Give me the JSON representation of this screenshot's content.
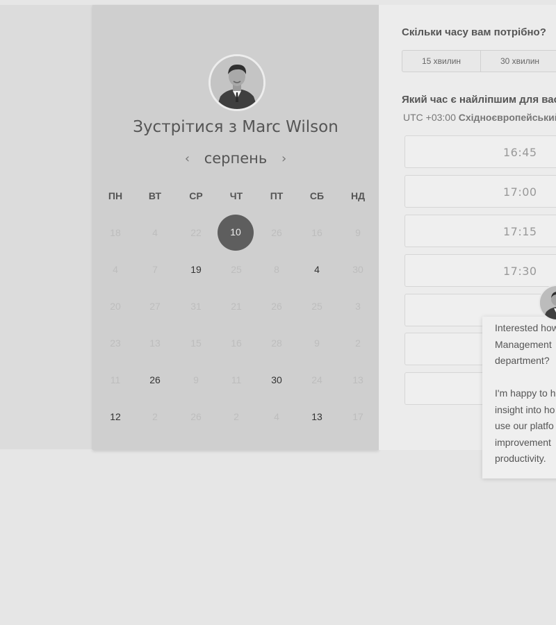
{
  "booking": {
    "title": "Зустрітися з Marc Wilson",
    "month": "серпень",
    "prev_icon": "‹",
    "next_icon": "›",
    "weekdays": [
      "ПН",
      "ВТ",
      "СР",
      "ЧТ",
      "ПТ",
      "СБ",
      "НД"
    ],
    "selected_day": "10",
    "days": [
      [
        "18",
        "4",
        "22",
        "10",
        "26",
        "16",
        "9"
      ],
      [
        "4",
        "7",
        "19",
        "25",
        "8",
        "4",
        "30"
      ],
      [
        "20",
        "27",
        "31",
        "21",
        "26",
        "25",
        "3"
      ],
      [
        "23",
        "13",
        "15",
        "16",
        "28",
        "9",
        "2"
      ],
      [
        "11",
        "26",
        "9",
        "11",
        "30",
        "24",
        "13"
      ],
      [
        "12",
        "2",
        "26",
        "2",
        "4",
        "13",
        "17"
      ]
    ]
  },
  "duration": {
    "question": "Скільки часу вам потрібно?",
    "options": [
      "15 хвилин",
      "30 хвилин"
    ]
  },
  "time": {
    "question": "Який час є найліпшим для вас?",
    "timezone_offset": "UTC +03:00",
    "timezone_name": "Східноєвропейський час",
    "slots": [
      "16:45",
      "17:00",
      "17:15",
      "17:30",
      "",
      "",
      ""
    ]
  },
  "chat": {
    "message": "Interested how\nManagement\ndepartment?\n\nI'm happy to h\ninsight into ho\nuse our platfo\nimprovement\nproductivity."
  }
}
